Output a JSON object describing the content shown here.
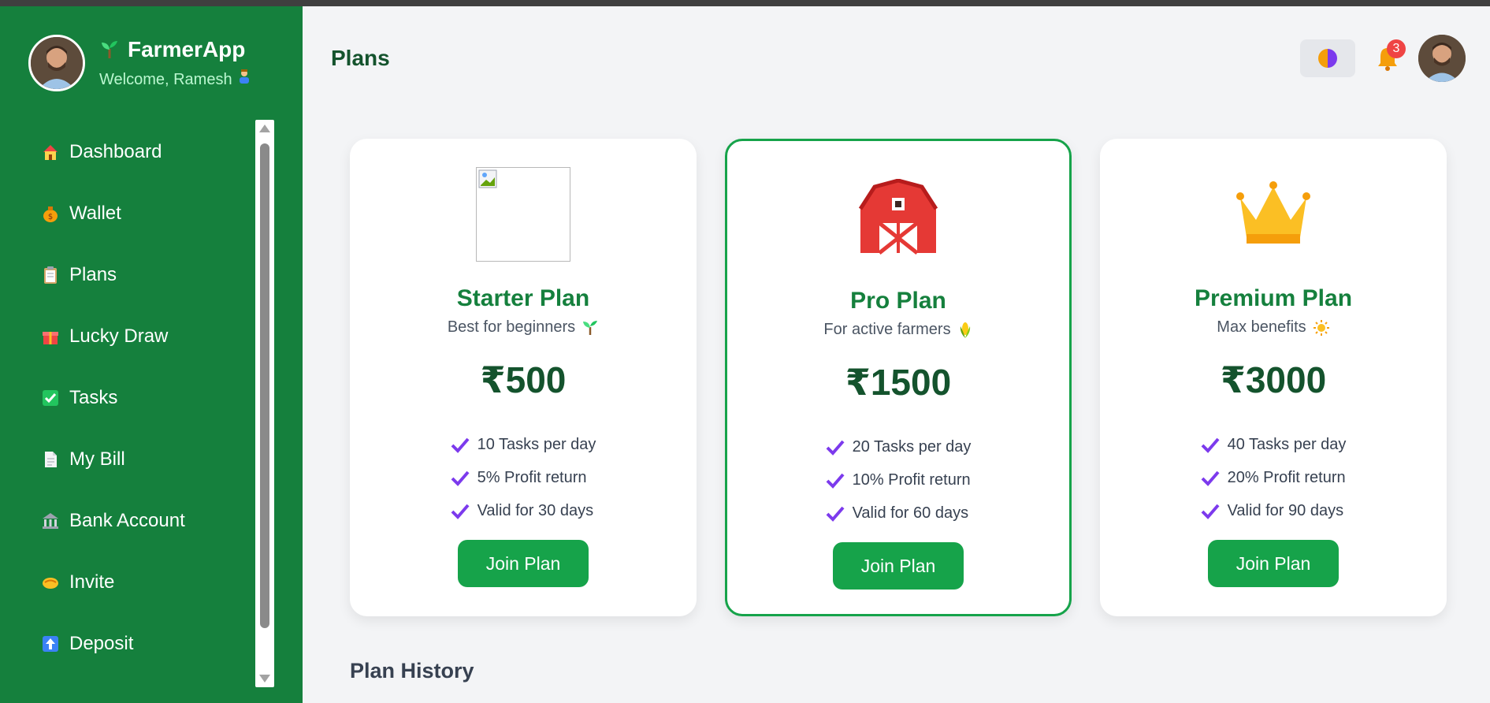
{
  "app": {
    "name": "FarmerApp",
    "welcome": "Welcome, Ramesh",
    "brand_icon": "seedling-icon"
  },
  "sidebar": {
    "items": [
      {
        "label": "Dashboard",
        "icon": "house-icon"
      },
      {
        "label": "Wallet",
        "icon": "money-bag-icon"
      },
      {
        "label": "Plans",
        "icon": "clipboard-icon"
      },
      {
        "label": "Lucky Draw",
        "icon": "gift-icon"
      },
      {
        "label": "Tasks",
        "icon": "check-box-icon"
      },
      {
        "label": "My Bill",
        "icon": "document-icon"
      },
      {
        "label": "Bank Account",
        "icon": "bank-icon"
      },
      {
        "label": "Invite",
        "icon": "handshake-icon"
      },
      {
        "label": "Deposit",
        "icon": "up-arrow-icon"
      }
    ]
  },
  "header": {
    "title": "Plans",
    "notification_count": "3"
  },
  "plans": [
    {
      "name": "Starter Plan",
      "subtitle": "Best for beginners",
      "price": "₹500",
      "features": [
        "10 Tasks per day",
        "5% Profit return",
        "Valid for 30 days"
      ],
      "button": "Join Plan"
    },
    {
      "name": "Pro Plan",
      "subtitle": "For active farmers",
      "price": "₹1500",
      "features": [
        "20 Tasks per day",
        "10% Profit return",
        "Valid for 60 days"
      ],
      "button": "Join Plan"
    },
    {
      "name": "Premium Plan",
      "subtitle": "Max benefits",
      "price": "₹3000",
      "features": [
        "40 Tasks per day",
        "20% Profit return",
        "Valid for 90 days"
      ],
      "button": "Join Plan"
    }
  ],
  "history": {
    "title": "Plan History"
  },
  "colors": {
    "sidebar": "#15803d",
    "accent": "#16a34a",
    "title": "#14532d",
    "badge": "#ef4444"
  }
}
